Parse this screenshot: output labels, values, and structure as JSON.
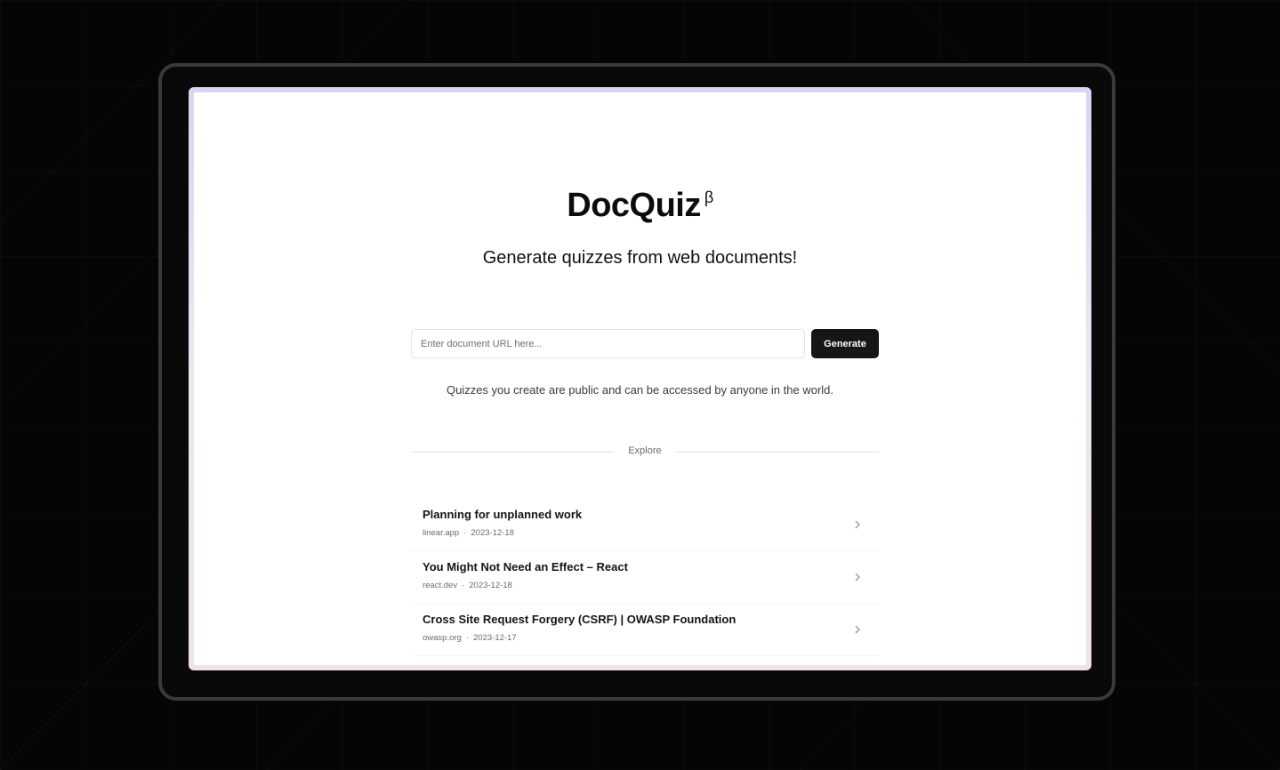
{
  "app": {
    "brand_name": "DocQuiz",
    "brand_badge": "β",
    "tagline": "Generate quizzes from web documents!"
  },
  "form": {
    "url_placeholder": "Enter document URL here...",
    "url_value": "",
    "generate_label": "Generate"
  },
  "notice": "Quizzes you create are public and can be accessed by anyone in the world.",
  "explore": {
    "label": "Explore",
    "items": [
      {
        "title": "Planning for unplanned work",
        "source": "linear.app",
        "separator": "·",
        "date": "2023-12-18",
        "icon": "chevron-right-icon"
      },
      {
        "title": "You Might Not Need an Effect – React",
        "source": "react.dev",
        "separator": "·",
        "date": "2023-12-18",
        "icon": "chevron-right-icon"
      },
      {
        "title": "Cross Site Request Forgery (CSRF) | OWASP Foundation",
        "source": "owasp.org",
        "separator": "·",
        "date": "2023-12-17",
        "icon": "chevron-right-icon"
      }
    ]
  },
  "colors": {
    "background": "#050505",
    "frame": "#3a3a3a",
    "button": "#161616",
    "text": "#0c0c0c"
  }
}
